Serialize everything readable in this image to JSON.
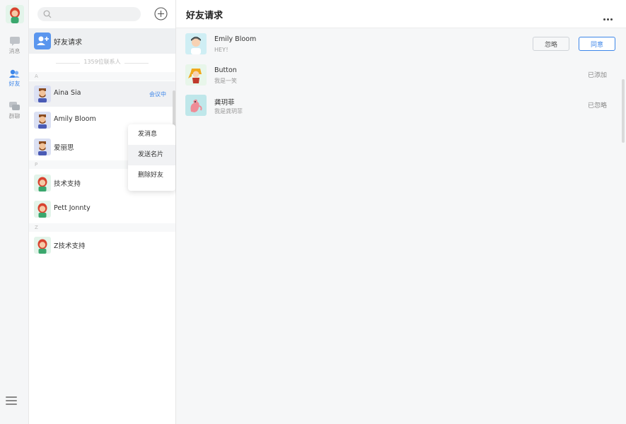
{
  "rail": {
    "nav": [
      {
        "label": "消息",
        "icon": "chat-icon"
      },
      {
        "label": "好友",
        "icon": "friends-icon",
        "active": true
      },
      {
        "label": "群聊",
        "icon": "group-icon"
      }
    ]
  },
  "contacts": {
    "search": {
      "placeholder": ""
    },
    "requests_label": "好友请求",
    "count_text": "1359位联系人",
    "sections": {
      "a": "A",
      "p": "P",
      "z": "Z"
    },
    "list": [
      {
        "name": "Aina Sia",
        "tag": "会议中"
      },
      {
        "name": "Amily Bloom"
      },
      {
        "name": "爱丽思"
      },
      {
        "name": "技术支持"
      },
      {
        "name": "Pett Jonnty"
      },
      {
        "name": "Z技术支持"
      }
    ],
    "context_menu": [
      "发消息",
      "发送名片",
      "删除好友"
    ]
  },
  "main": {
    "title": "好友请求",
    "requests": [
      {
        "name": "Emily Bloom",
        "message": "HEY！",
        "ignore_label": "忽略",
        "agree_label": "同意"
      },
      {
        "name": "Button",
        "message": "我是一笑",
        "status": "已添加"
      },
      {
        "name": "龚玥菲",
        "message": "我是龚玥菲",
        "status": "已忽略"
      }
    ]
  },
  "colors": {
    "accent": "#3d86e9",
    "rail_bg": "#f5f6f7",
    "main_bg": "#f6f7f8"
  }
}
